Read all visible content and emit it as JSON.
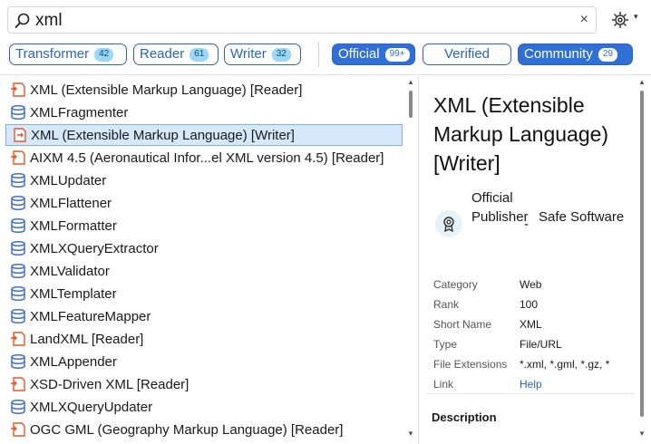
{
  "search": {
    "query": "xml",
    "clear_glyph": "×"
  },
  "settings": {
    "caret": "▾"
  },
  "filters": [
    {
      "label": "Transformer",
      "count": "42",
      "active": false
    },
    {
      "label": "Reader",
      "count": "61",
      "active": false
    },
    {
      "label": "Writer",
      "count": "32",
      "active": false
    },
    {
      "label": "Official",
      "count": "99+",
      "active": true
    },
    {
      "label": "Verified",
      "count": "",
      "active": false
    },
    {
      "label": "Community",
      "count": "29",
      "active": true
    }
  ],
  "results": [
    {
      "label": "XML (Extensible Markup Language) [Reader]",
      "icon": "reader-icon"
    },
    {
      "label": "XMLFragmenter",
      "icon": "transformer-icon"
    },
    {
      "label": "XML (Extensible Markup Language) [Writer]",
      "icon": "writer-icon",
      "selected": true
    },
    {
      "label": "AIXM 4.5 (Aeronautical Infor...el XML version 4.5) [Reader]",
      "icon": "reader-icon"
    },
    {
      "label": "XMLUpdater",
      "icon": "transformer-icon"
    },
    {
      "label": "XMLFlattener",
      "icon": "transformer-icon"
    },
    {
      "label": "XMLFormatter",
      "icon": "transformer-icon"
    },
    {
      "label": "XMLXQueryExtractor",
      "icon": "transformer-icon"
    },
    {
      "label": "XMLValidator",
      "icon": "transformer-icon"
    },
    {
      "label": "XMLTemplater",
      "icon": "transformer-icon"
    },
    {
      "label": "XMLFeatureMapper",
      "icon": "transformer-icon"
    },
    {
      "label": "LandXML [Reader]",
      "icon": "reader-icon"
    },
    {
      "label": "XMLAppender",
      "icon": "transformer-icon"
    },
    {
      "label": "XSD-Driven XML [Reader]",
      "icon": "reader-icon"
    },
    {
      "label": "XMLXQueryUpdater",
      "icon": "transformer-icon"
    },
    {
      "label": "OGC GML (Geography Markup Language) [Reader]",
      "icon": "reader-icon"
    }
  ],
  "detail": {
    "title": "XML (Extensible Markup Language) [Writer]",
    "publisher_type": "Official Publisher",
    "separator": "-",
    "publisher": "Safe Software",
    "properties": [
      {
        "key": "Category",
        "value": "Web"
      },
      {
        "key": "Rank",
        "value": "100"
      },
      {
        "key": "Short Name",
        "value": "XML"
      },
      {
        "key": "Type",
        "value": "File/URL"
      },
      {
        "key": "File Extensions",
        "value": "*.xml, *.gml, *.gz, *"
      },
      {
        "key": "Link",
        "value": "Help"
      }
    ],
    "description_heading": "Description"
  },
  "colors": {
    "accent": "#2f6fd6",
    "reader_icon": "#e2572b",
    "transformer_icon": "#3f6fd0",
    "selection": "#d6e8fb"
  }
}
